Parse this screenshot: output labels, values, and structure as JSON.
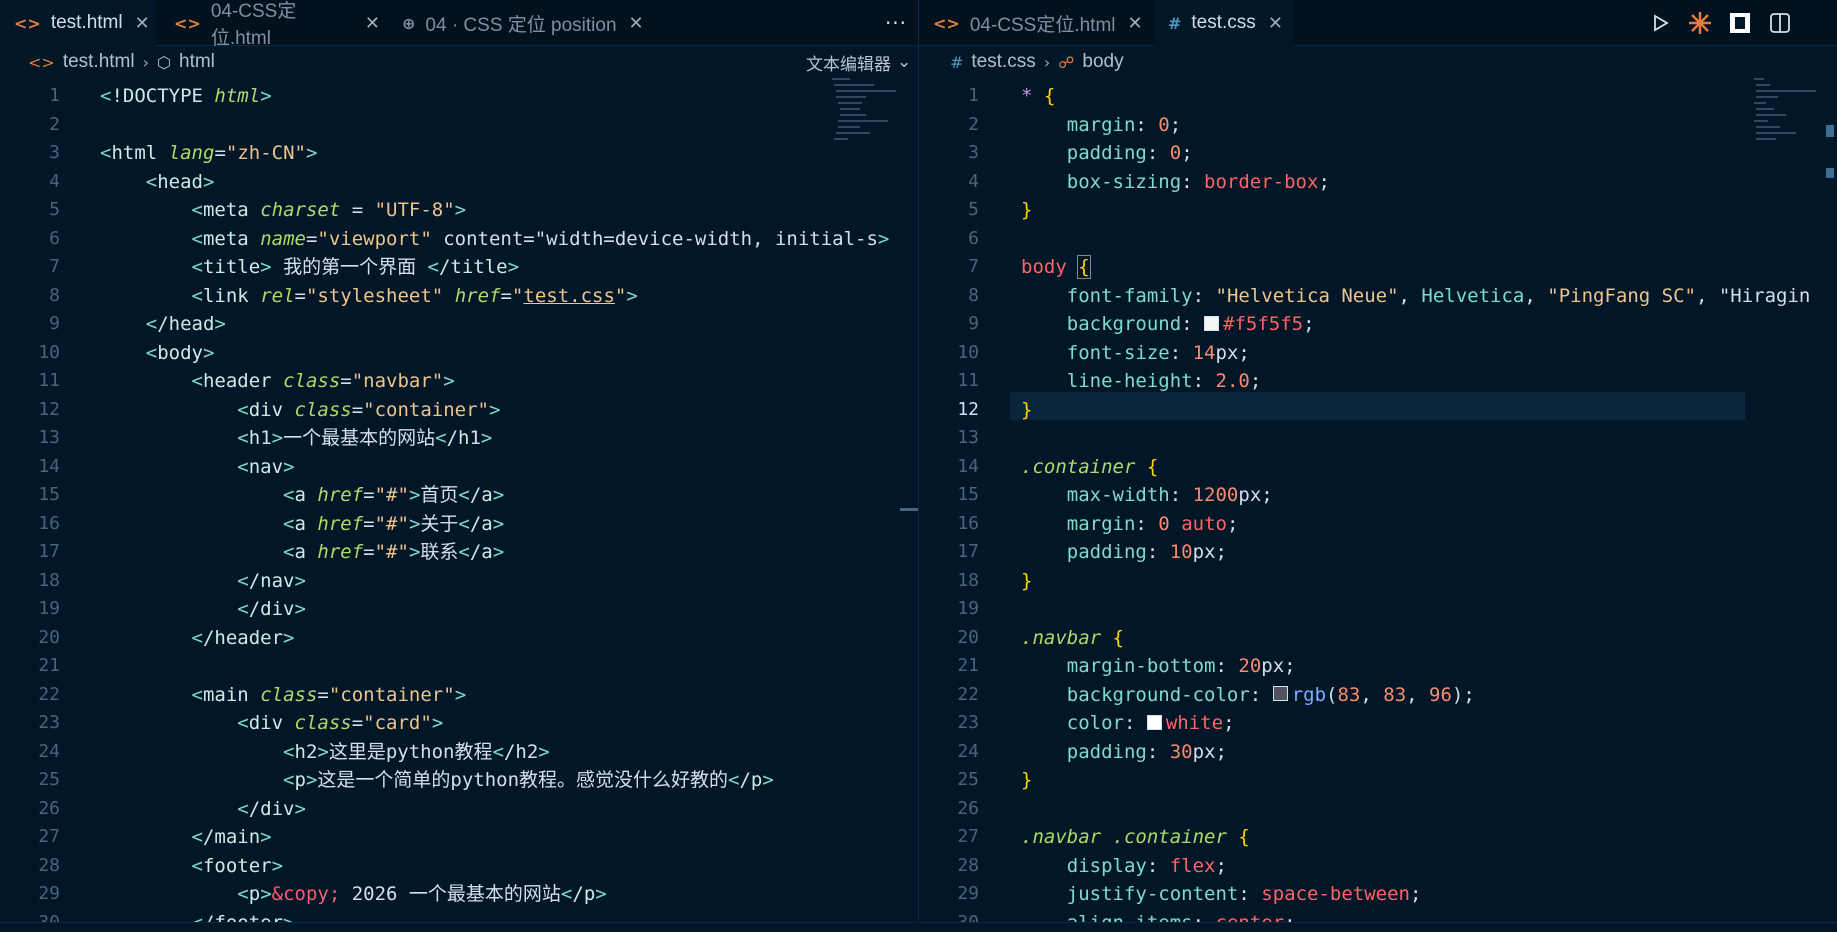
{
  "left_tabs": [
    {
      "label": "test.html",
      "icon": "html-icon",
      "active": true
    },
    {
      "label": "04-CSS定位.html",
      "icon": "html-icon",
      "active": false
    },
    {
      "label": "04 · CSS 定位 position",
      "icon": "globe-icon",
      "active": false
    }
  ],
  "right_tabs": [
    {
      "label": "04-CSS定位.html",
      "icon": "html-icon",
      "active": false
    },
    {
      "label": "test.css",
      "icon": "css-icon",
      "active": true
    }
  ],
  "left_breadcrumb": {
    "file": "test.html",
    "symbol": "html"
  },
  "right_breadcrumb": {
    "file": "test.css",
    "symbol": "body"
  },
  "text_editor_button": "文本编辑器",
  "icons": {
    "close": "close-icon",
    "more": "more-actions-icon",
    "run": "run-icon",
    "split": "split-editor-icon"
  },
  "colors": {
    "background": "#011627",
    "html_icon": "#e0803f",
    "css_icon": "#519aba"
  },
  "html_lines": [
    "<!DOCTYPE html>",
    "",
    "<html lang=\"zh-CN\">",
    "    <head>",
    "        <meta charset = \"UTF-8\">",
    "        <meta name=\"viewport\" content=\"width=device-width, initial-sc",
    "        <title> 我的第一个界面 </title>",
    "        <link rel=\"stylesheet\" href=\"test.css\">",
    "    </head>",
    "    <body>",
    "        <header class=\"navbar\">",
    "            <div class=\"container\">",
    "            <h1>一个最基本的网站</h1>",
    "            <nav>",
    "                <a href=\"#\">首页</a>",
    "                <a href=\"#\">关于</a>",
    "                <a href=\"#\">联系</a>",
    "            </nav>",
    "            </div>",
    "        </header>",
    "",
    "        <main class=\"container\">",
    "            <div class=\"card\">",
    "                <h2>这里是python教程</h2>",
    "                <p>这是一个简单的python教程。感觉没什么好教的</p>",
    "            </div>",
    "        </main>",
    "        <footer>",
    "            <p>&copy; 2026 一个最基本的网站</p>",
    "        </footer>"
  ],
  "css_lines": [
    "* {",
    "    margin: 0;",
    "    padding: 0;",
    "    box-sizing: border-box;",
    "}",
    "",
    "body {",
    "    font-family: \"Helvetica Neue\", Helvetica, \"PingFang SC\", \"Hiragin",
    "    background: #f5f5f5;",
    "    font-size: 14px;",
    "    line-height: 2.0;",
    "}",
    "",
    ".container {",
    "    max-width: 1200px;",
    "    margin: 0 auto;",
    "    padding: 10px;",
    "}",
    "",
    ".navbar {",
    "    margin-bottom: 20px;",
    "    background-color: rgb(83, 83, 96);",
    "    color: white;",
    "    padding: 30px;",
    "}",
    "",
    ".navbar .container {",
    "    display: flex;",
    "    justify-content: space-between;",
    "    align-items: center;"
  ],
  "current_line_right": 12
}
